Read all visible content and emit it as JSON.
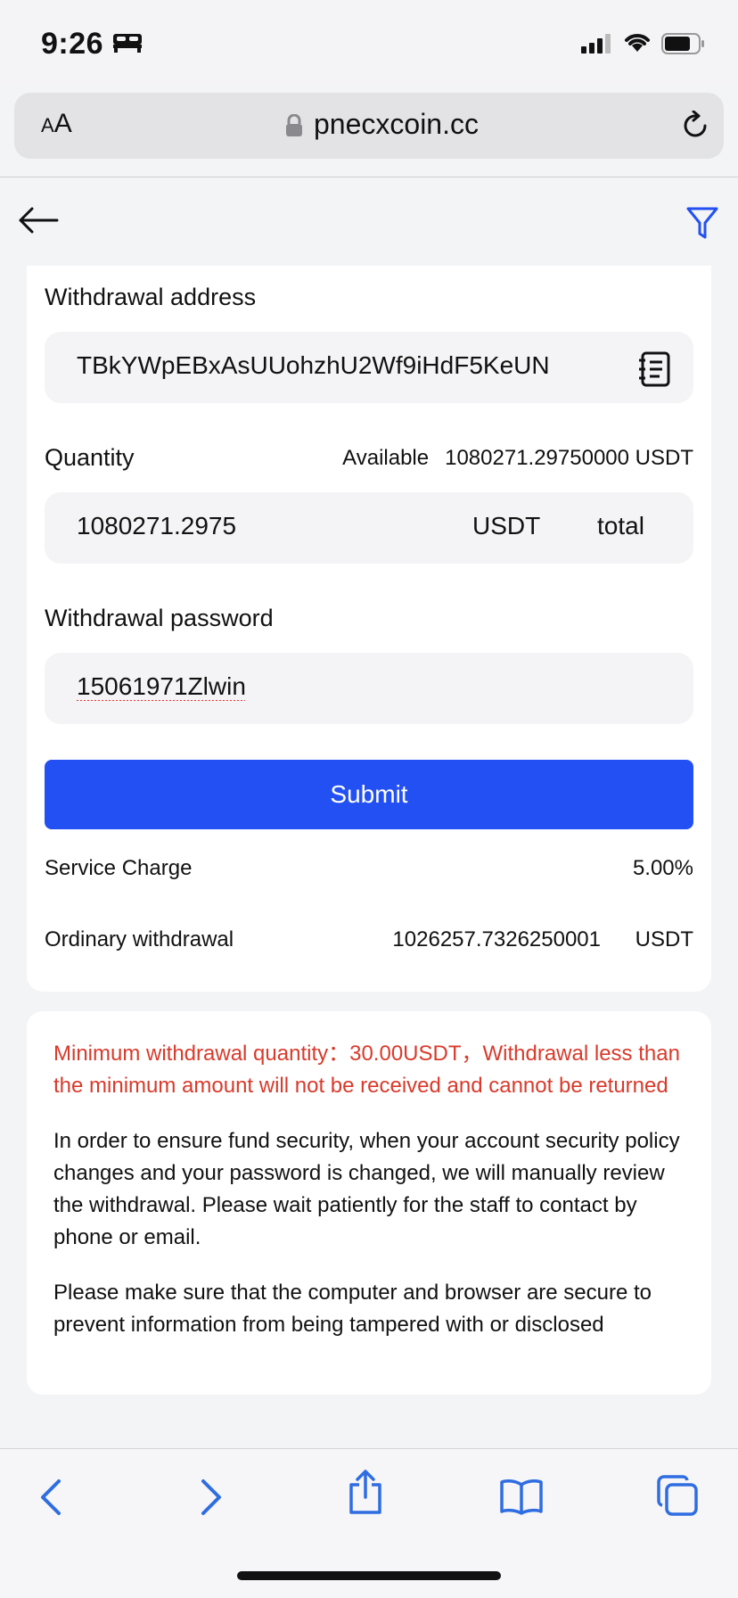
{
  "status_bar": {
    "time": "9:26"
  },
  "browser": {
    "aa_large": "A",
    "aa_small": "A",
    "url": "pnecxcoin.cc"
  },
  "form": {
    "address_label": "Withdrawal address",
    "address_value": "TBkYWpEBxAsUUohzhU2Wf9iHdF5KeUN",
    "quantity_label": "Quantity",
    "available_label": "Available",
    "available_value": "1080271.29750000 USDT",
    "quantity_value": "1080271.2975",
    "quantity_unit": "USDT",
    "total_label": "total",
    "password_label": "Withdrawal password",
    "password_value": "15061971Zlwin",
    "submit_label": "Submit",
    "service_charge_label": "Service Charge",
    "service_charge_value": "5.00%",
    "ordinary_label": "Ordinary withdrawal",
    "ordinary_value": "1026257.7326250001",
    "ordinary_unit": "USDT"
  },
  "info": {
    "warning": "Minimum withdrawal quantity：30.00USDT，Withdrawal less than the minimum amount will not be received and cannot be returned",
    "security_note": "In order to ensure fund security, when your account security policy changes and your password is changed, we will manually review the withdrawal. Please wait patiently for the staff to contact by phone or email.",
    "browser_note": "Please make sure that the computer and browser are secure to prevent information from being tampered with or disclosed"
  },
  "colors": {
    "accent": "#2350f2",
    "warning": "#d93a2b"
  }
}
